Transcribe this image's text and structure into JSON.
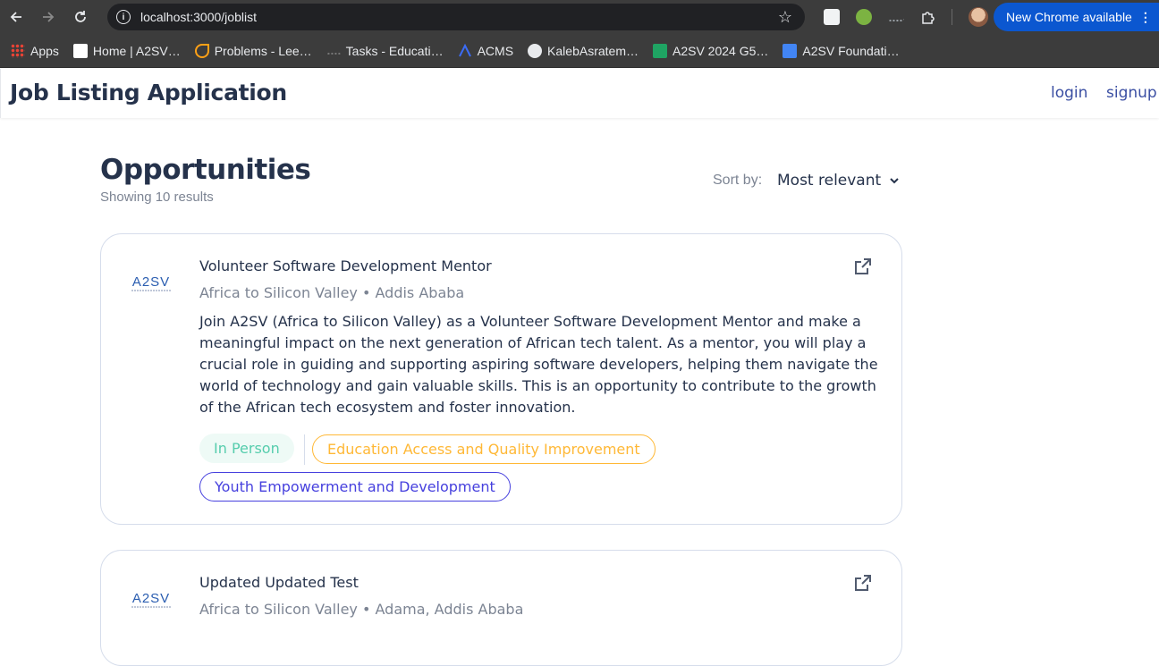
{
  "browser": {
    "url": "localhost:3000/joblist",
    "update_button": "New Chrome available",
    "bookmarks": [
      {
        "label": "Apps",
        "icon": "apps-grid-icon"
      },
      {
        "label": "Home | A2SV…",
        "icon": "a2sv-home-icon"
      },
      {
        "label": "Problems - Lee…",
        "icon": "leetcode-icon"
      },
      {
        "label": "Tasks - Educati…",
        "icon": "tasks-icon"
      },
      {
        "label": "ACMS",
        "icon": "acms-icon"
      },
      {
        "label": "KalebAsratem…",
        "icon": "github-icon"
      },
      {
        "label": "A2SV 2024 G5…",
        "icon": "sheets-icon"
      },
      {
        "label": "A2SV Foundati…",
        "icon": "calendar-icon"
      }
    ]
  },
  "header": {
    "title": "Job Listing Application",
    "login": "login",
    "signup": "signup"
  },
  "main": {
    "heading": "Opportunities",
    "results": "Showing 10 results",
    "sort_label": "Sort by:",
    "sort_value": "Most relevant"
  },
  "jobs": [
    {
      "logo": "A2SV",
      "title": "Volunteer Software Development Mentor",
      "subtitle": "Africa to Silicon Valley • Addis Ababa",
      "description": "Join A2SV (Africa to Silicon Valley) as a Volunteer Software Development Mentor and make a meaningful impact on the next generation of African tech talent. As a mentor, you will play a crucial role in guiding and supporting aspiring software developers, helping them navigate the world of technology and gain valuable skills. This is an opportunity to contribute to the growth of the African tech ecosystem and foster innovation.",
      "type": "In Person",
      "categories": [
        "Education Access and Quality Improvement",
        "Youth Empowerment and Development"
      ]
    },
    {
      "logo": "A2SV",
      "title": "Updated Updated Test",
      "subtitle": "Africa to Silicon Valley • Adama, Addis Ababa"
    }
  ],
  "colors": {
    "heading": "#25324b",
    "muted": "#7c8493",
    "tag_green": "#56cdad",
    "tag_orange": "#ffb836",
    "tag_purple": "#4640de",
    "link": "#3b4fa3"
  }
}
